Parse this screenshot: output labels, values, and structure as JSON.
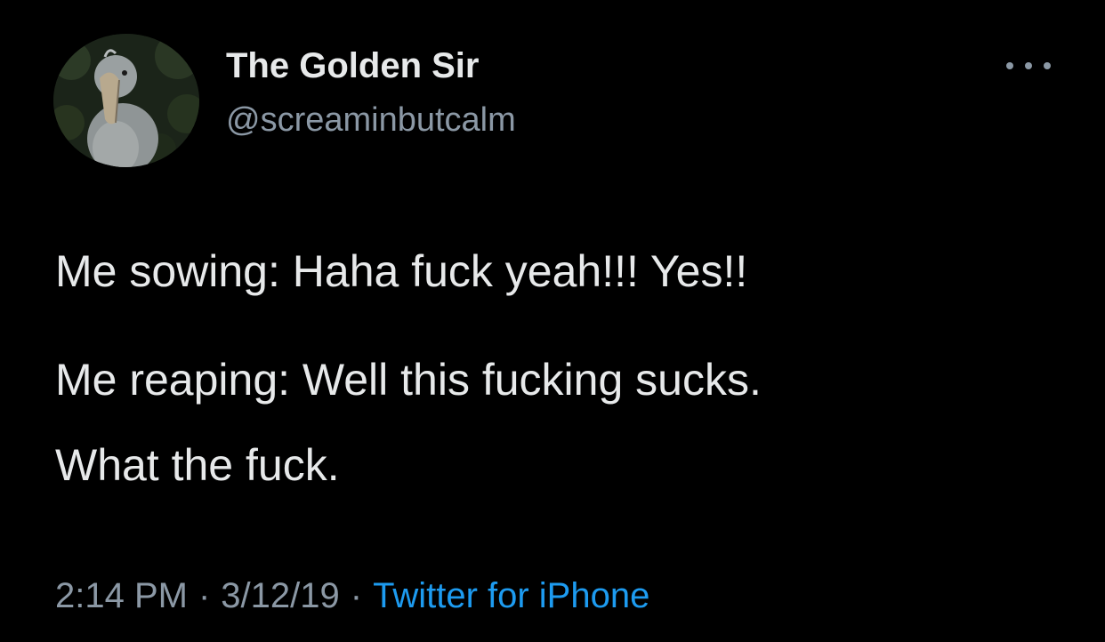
{
  "author": {
    "display_name": "The Golden Sir",
    "handle": "@screaminbutcalm",
    "avatar_icon": "shoebill-bird-avatar"
  },
  "tweet": {
    "line1": "Me sowing: Haha fuck yeah!!! Yes!!",
    "line2": "Me reaping: Well this fucking sucks.",
    "line3": "What the fuck."
  },
  "meta": {
    "time": "2:14 PM",
    "separator": "·",
    "date": "3/12/19",
    "source": "Twitter for iPhone"
  },
  "colors": {
    "background": "#000000",
    "text": "#e7e9ea",
    "muted": "#8b98a5",
    "link": "#1d9bf0"
  },
  "more_icon": "more-dots-icon"
}
